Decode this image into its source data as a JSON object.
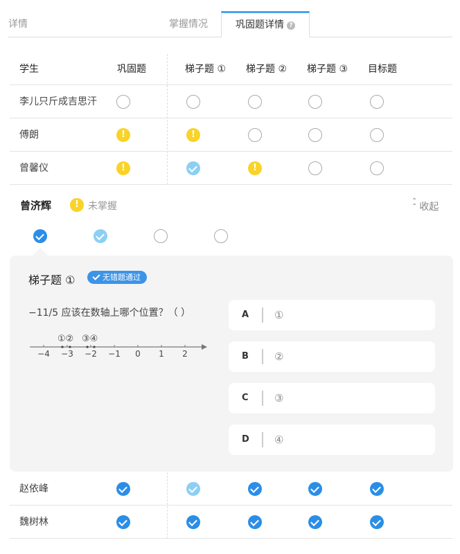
{
  "tabs": {
    "detail": "详情",
    "mastery": "掌握情况",
    "active": "巩固题详情"
  },
  "table": {
    "headers": [
      "学生",
      "巩固题",
      "梯子题 ①",
      "梯子题 ②",
      "梯子题 ③",
      "目标题"
    ],
    "rows_top": [
      {
        "name": "李儿只斤成吉思汗",
        "statuses": [
          "none",
          "none",
          "none",
          "none",
          "none"
        ]
      },
      {
        "name": "傅朗",
        "statuses": [
          "warn",
          "warn",
          "none",
          "none",
          "none"
        ]
      },
      {
        "name": "曾馨仪",
        "statuses": [
          "warn",
          "retry",
          "warn",
          "none",
          "none"
        ]
      }
    ],
    "rows_bottom": [
      {
        "name": "赵依峰",
        "statuses": [
          "ok",
          "retry",
          "ok",
          "ok",
          "ok"
        ]
      },
      {
        "name": "魏树林",
        "statuses": [
          "ok",
          "ok",
          "ok",
          "ok",
          "ok"
        ]
      }
    ]
  },
  "expanded": {
    "student": "曾济辉",
    "status_label": "未掌握",
    "collapse_label": "收起",
    "question_dots": [
      "ok",
      "retry",
      "none",
      "none"
    ],
    "question": {
      "title": "梯子题 ①",
      "badge": "无错题通过",
      "text": "−11/5  应该在数轴上哪个位置？（  ）",
      "numberline_ticks": [
        "−4",
        "−3",
        "−2",
        "−1",
        "0",
        "1",
        "2"
      ],
      "numberline_markers": [
        "①②",
        "③④"
      ],
      "options": [
        {
          "letter": "A",
          "value": "①"
        },
        {
          "letter": "B",
          "value": "②"
        },
        {
          "letter": "C",
          "value": "③"
        },
        {
          "letter": "D",
          "value": "④"
        }
      ]
    }
  },
  "icons": {
    "none": "empty-circle-icon",
    "warn": "warning-icon",
    "ok": "check-icon",
    "retry": "retry-check-icon"
  },
  "colors": {
    "accent": "#2b8ee6",
    "warn": "#f9d328",
    "retry": "#8dcff4",
    "tab_active_border": "#4aa3e8"
  }
}
